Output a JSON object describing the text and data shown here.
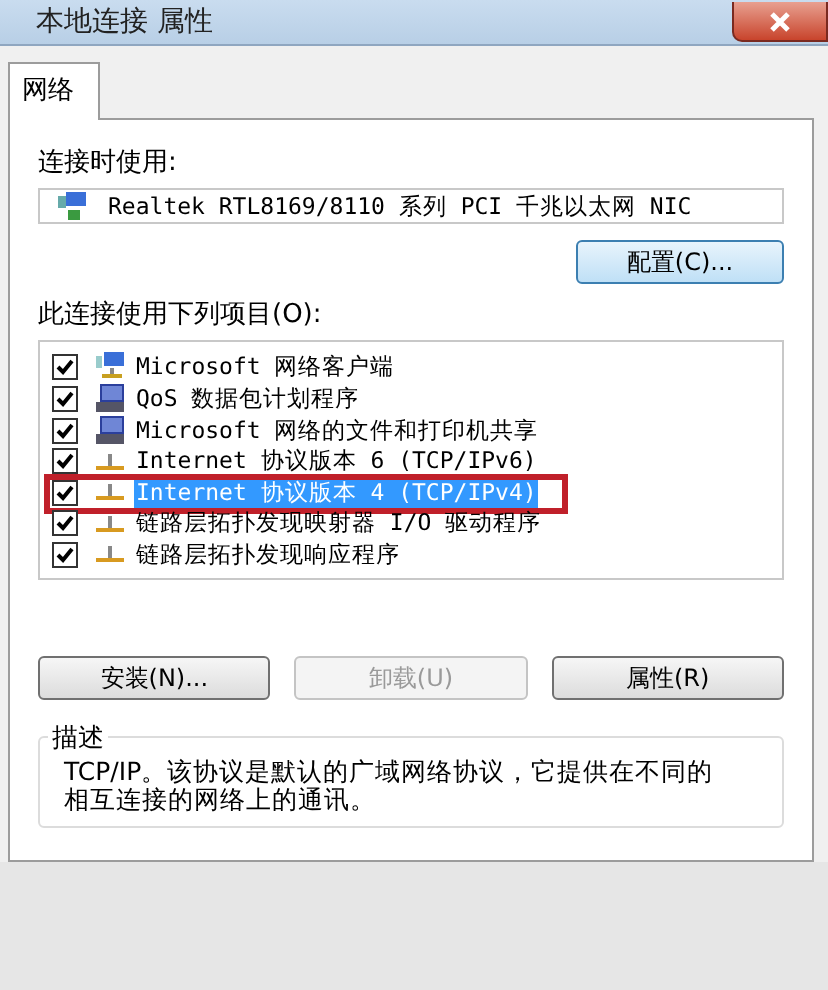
{
  "window": {
    "title": "本地连接 属性"
  },
  "tabs": [
    {
      "label": "网络",
      "selected": true
    }
  ],
  "connect_using": {
    "label": "连接时使用:",
    "adapter": "Realtek RTL8169/8110 系列 PCI 千兆以太网 NIC",
    "configure_button": "配置(C)..."
  },
  "items_label": "此连接使用下列项目(O):",
  "items": [
    {
      "label": "Microsoft 网络客户端",
      "kind": "client",
      "checked": true,
      "selected": false,
      "annotated": false
    },
    {
      "label": "QoS 数据包计划程序",
      "kind": "service",
      "checked": true,
      "selected": false,
      "annotated": false
    },
    {
      "label": "Microsoft 网络的文件和打印机共享",
      "kind": "service",
      "checked": true,
      "selected": false,
      "annotated": false
    },
    {
      "label": "Internet 协议版本 6 (TCP/IPv6)",
      "kind": "protocol",
      "checked": true,
      "selected": false,
      "annotated": false
    },
    {
      "label": "Internet 协议版本 4 (TCP/IPv4)",
      "kind": "protocol",
      "checked": true,
      "selected": true,
      "annotated": true
    },
    {
      "label": "链路层拓扑发现映射器 I/O 驱动程序",
      "kind": "protocol",
      "checked": true,
      "selected": false,
      "annotated": false
    },
    {
      "label": "链路层拓扑发现响应程序",
      "kind": "protocol",
      "checked": true,
      "selected": false,
      "annotated": false
    }
  ],
  "buttons": [
    {
      "label": "安装(N)...",
      "disabled": false
    },
    {
      "label": "卸载(U)",
      "disabled": true
    },
    {
      "label": "属性(R)",
      "disabled": false
    }
  ],
  "description": {
    "title": "描述",
    "text": "TCP/IP。该协议是默认的广域网络协议，它提供在不同的相互连接的网络上的通讯。"
  }
}
